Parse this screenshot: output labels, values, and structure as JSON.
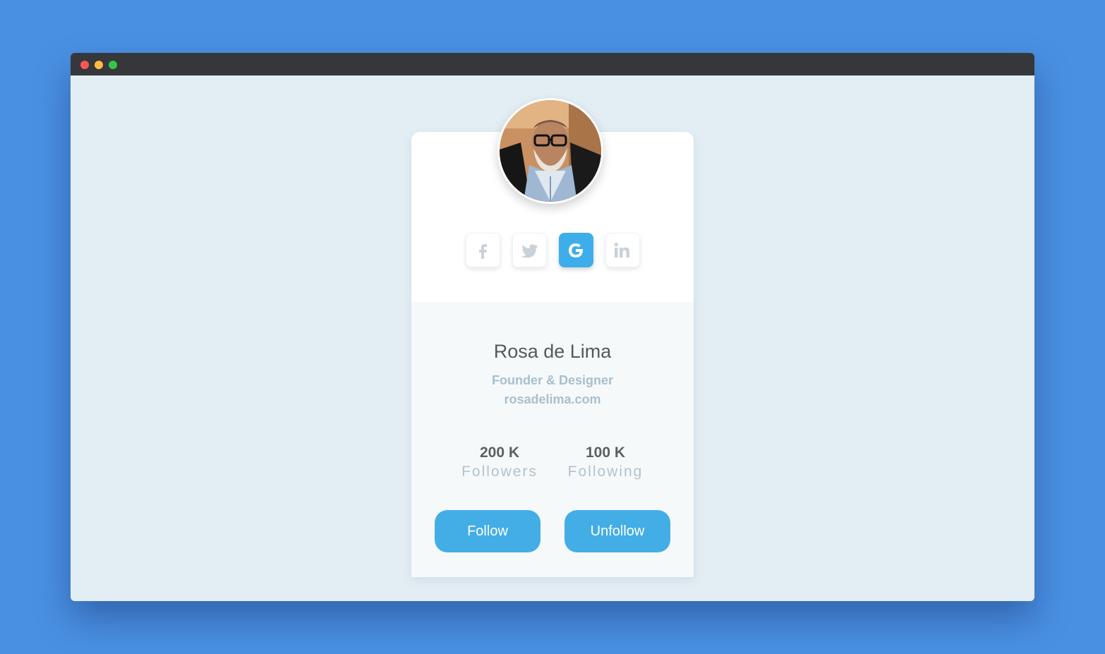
{
  "colors": {
    "background": "#4a90e2",
    "window_body": "#e3eef4",
    "titlebar": "#36373b",
    "accent": "#43ade6",
    "google_active": "#3daee9",
    "muted_text": "#a8bfcd"
  },
  "window": {
    "controls": [
      "close-dot",
      "minimize-dot",
      "maximize-dot"
    ]
  },
  "profile": {
    "avatar_icon": "person-photo-avatar",
    "name": "Rosa de Lima",
    "role": "Founder & Designer",
    "website": "rosadelima.com",
    "socials": [
      {
        "icon": "facebook-icon",
        "active": false
      },
      {
        "icon": "twitter-icon",
        "active": false
      },
      {
        "icon": "google-icon",
        "active": true
      },
      {
        "icon": "linkedin-icon",
        "active": false
      }
    ],
    "stats": {
      "followers": {
        "value": "200 K",
        "label": "Followers"
      },
      "following": {
        "value": "100 K",
        "label": "Following"
      }
    },
    "buttons": {
      "follow": "Follow",
      "unfollow": "Unfollow"
    }
  }
}
